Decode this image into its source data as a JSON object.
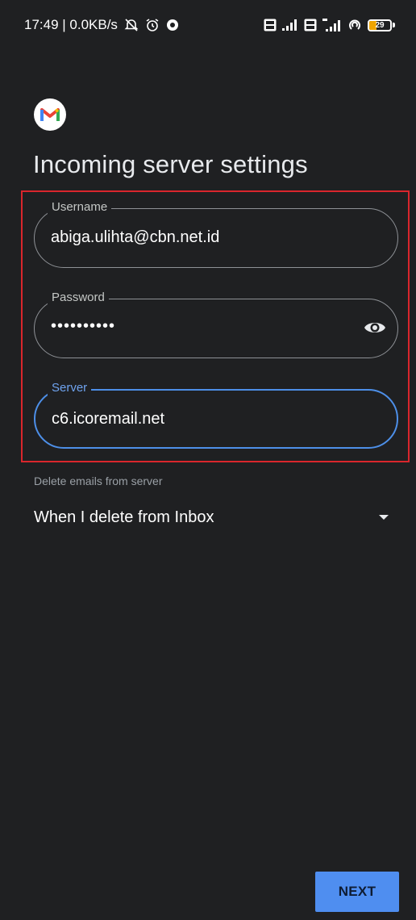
{
  "status_bar": {
    "time_speed": "17:49 | 0.0KB/s",
    "battery_level": "29",
    "icons": [
      "no-alarm-icon",
      "alarm-icon",
      "vpn-icon",
      "volte-icon",
      "signal-icon",
      "volte-icon",
      "4g-signal-icon",
      "hotspot-icon",
      "battery-icon"
    ]
  },
  "app": {
    "logo_icon": "gmail-logo-icon",
    "title": "Incoming server settings"
  },
  "form": {
    "username": {
      "label": "Username",
      "value": "abiga.ulihta@cbn.net.id"
    },
    "password": {
      "label": "Password",
      "value": "••••••••••"
    },
    "server": {
      "label": "Server",
      "value": "c6.icoremail.net"
    }
  },
  "delete_setting": {
    "label": "Delete emails from server",
    "selected": "When I delete from Inbox"
  },
  "actions": {
    "next_label": "NEXT"
  },
  "colors": {
    "background": "#1f2022",
    "accent": "#4f8ef0",
    "focus_border": "#4d8fe8",
    "highlight_box": "#d9262c"
  }
}
